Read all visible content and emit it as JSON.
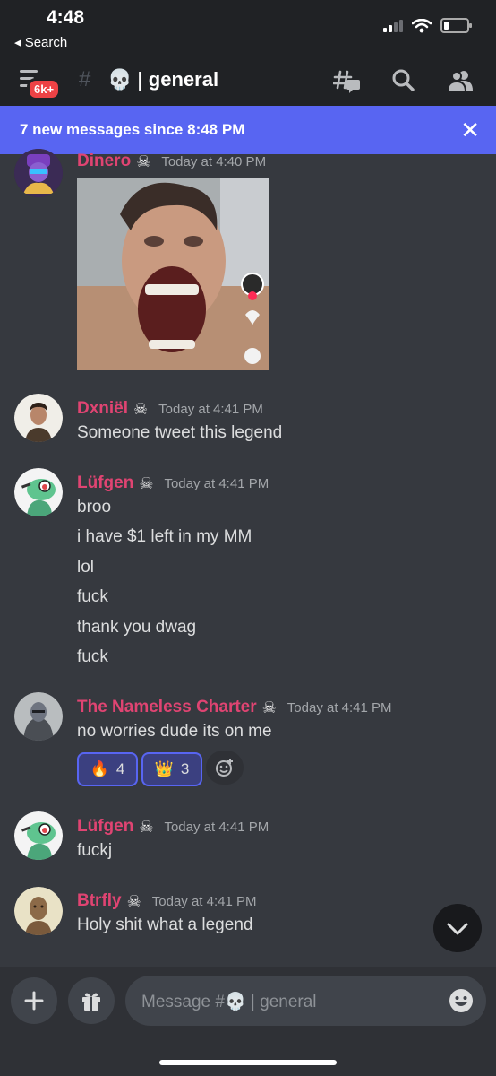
{
  "status_bar": {
    "time": "4:48",
    "back_label": "◂ Search"
  },
  "header": {
    "unread_badge": "6k+",
    "channel_prefix": "#",
    "channel_emoji": "💀",
    "channel_name": "| general"
  },
  "banner": {
    "text": "7 new messages since 8:48 PM",
    "close": "✕"
  },
  "messages": [
    {
      "author": "Dinero",
      "badge": "☠",
      "timestamp": "Today at 4:40 PM",
      "lines": []
    },
    {
      "author": "Dxniël",
      "badge": "☠",
      "timestamp": "Today at 4:41 PM",
      "lines": [
        "Someone tweet this legend"
      ]
    },
    {
      "author": "Lüfgen",
      "badge": "☠",
      "timestamp": "Today at 4:41 PM",
      "lines": [
        "broo",
        "i have $1 left in my MM",
        "lol",
        "fuck",
        "thank you dwag",
        "fuck"
      ]
    },
    {
      "author": "The Nameless Charter",
      "badge": "☠",
      "timestamp": "Today at 4:41 PM",
      "lines": [
        "no worries dude its on me"
      ]
    },
    {
      "author": "Lüfgen",
      "badge": "☠",
      "timestamp": "Today at 4:41 PM",
      "lines": [
        "fuckj"
      ]
    },
    {
      "author": "Btrfly",
      "badge": "☠",
      "timestamp": "Today at 4:41 PM",
      "lines": [
        "Holy shit what a legend"
      ]
    }
  ],
  "reactions": [
    {
      "emoji": "🔥",
      "count": "4"
    },
    {
      "emoji": "👑",
      "count": "3"
    }
  ],
  "composer": {
    "placeholder_prefix": "Message #",
    "placeholder_emoji": "💀",
    "placeholder_channel": "| general"
  },
  "colors": {
    "accent": "#5865f2",
    "author": "#e04472",
    "background": "#36393f",
    "header": "#202225"
  }
}
